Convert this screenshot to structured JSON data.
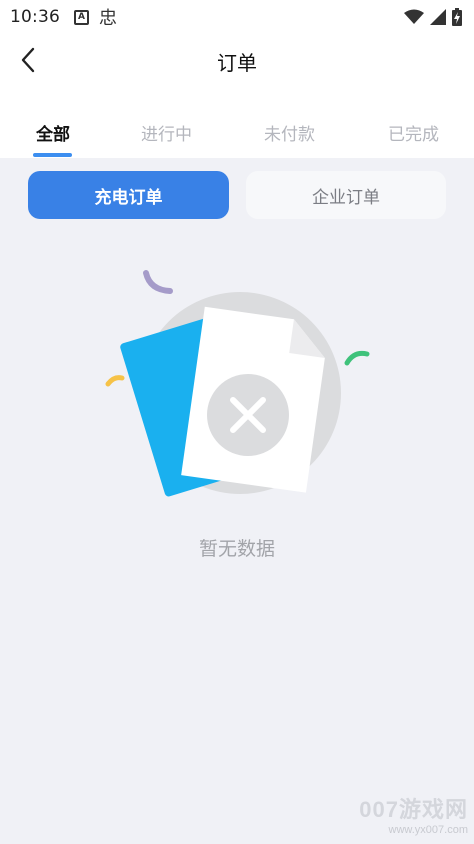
{
  "status_bar": {
    "time": "10:36",
    "app_icon_letter": "A",
    "app_icon2_glyph": "忠",
    "icons": [
      "wifi-icon",
      "signal-icon",
      "battery-icon"
    ]
  },
  "header": {
    "title": "订单",
    "back_icon": "chevron-left-icon"
  },
  "tabs": [
    {
      "label": "全部",
      "active": true
    },
    {
      "label": "进行中",
      "active": false
    },
    {
      "label": "未付款",
      "active": false
    },
    {
      "label": "已完成",
      "active": false
    }
  ],
  "toggle": {
    "charging_orders": "充电订单",
    "enterprise_orders": "企业订单",
    "selected": "充电订单"
  },
  "empty_state": {
    "message": "暂无数据",
    "icon": "empty-document-icon"
  },
  "watermark": {
    "main": "007游戏网",
    "sub": "www.yx007.com"
  },
  "colors": {
    "accent": "#3981e6",
    "tab_underline": "#3c8ef0",
    "background": "#f0f1f6",
    "card_blue": "#1ab0ef"
  }
}
